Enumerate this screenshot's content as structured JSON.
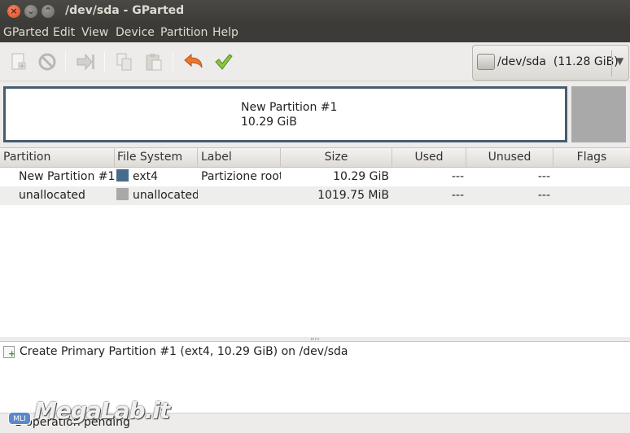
{
  "window": {
    "title": "/dev/sda - GParted",
    "close": "×",
    "minimize": "⌄",
    "maximize": "⌃"
  },
  "menu": [
    "GParted",
    "Edit",
    "View",
    "Device",
    "Partition",
    "Help"
  ],
  "toolbar": {
    "icons": [
      "new-partition-icon",
      "delete-icon",
      "resize-move-icon",
      "copy-icon",
      "paste-icon",
      "undo-icon",
      "apply-icon"
    ],
    "device": "/dev/sda  (11.28 GiB)",
    "dropdown_arrow": "▼"
  },
  "disk_map": {
    "name": "New Partition #1",
    "size": "10.29 GiB"
  },
  "table": {
    "columns": [
      "Partition",
      "File System",
      "Label",
      "Size",
      "Used",
      "Unused",
      "Flags"
    ],
    "rows": [
      {
        "partition": "New Partition #1",
        "fs": "ext4",
        "fs_color": "#476b8b",
        "label": "Partizione root",
        "size": "10.29 GiB",
        "used": "---",
        "unused": "---",
        "flags": ""
      },
      {
        "partition": "unallocated",
        "fs": "unallocated",
        "fs_color": "#a9a9a9",
        "label": "",
        "size": "1019.75 MiB",
        "used": "---",
        "unused": "---",
        "flags": ""
      }
    ]
  },
  "operations": [
    "Create Primary Partition #1 (ext4, 10.29 GiB) on /dev/sda"
  ],
  "status": "1 operation pending",
  "watermark": {
    "badge": "MLI",
    "text": "MegaLab.it"
  },
  "colors": {
    "partition_border": "#465c70",
    "unallocated": "#a9a9a9",
    "ext4": "#476b8b",
    "titlebar": "#3c3b37"
  }
}
